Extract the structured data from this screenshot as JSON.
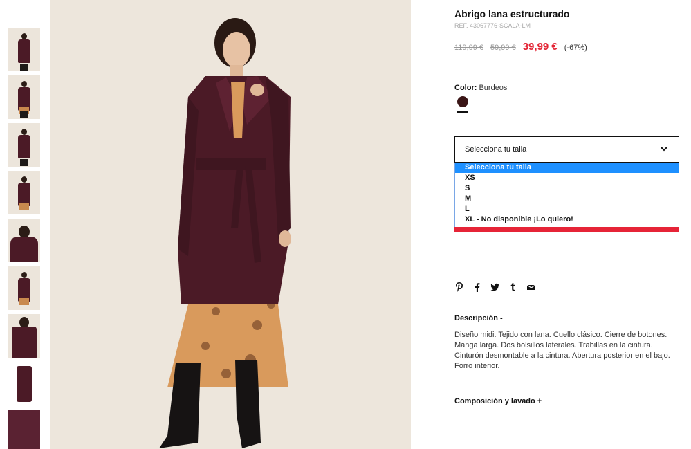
{
  "thumbnails": [
    {
      "alt": "front-full"
    },
    {
      "alt": "front-full-2"
    },
    {
      "alt": "front-walk"
    },
    {
      "alt": "front-mid"
    },
    {
      "alt": "closeup"
    },
    {
      "alt": "side"
    },
    {
      "alt": "back"
    },
    {
      "alt": "flat"
    },
    {
      "alt": "detail"
    }
  ],
  "product": {
    "title": "Abrigo lana estructurado",
    "ref": "REF. 43067776-SCALA-LM",
    "prices": {
      "original": "119,99 €",
      "previous": "59,99 €",
      "sale": "39,99 €",
      "discount": "(-67%)"
    },
    "color": {
      "label": "Color:",
      "value": "Burdeos",
      "swatch_hex": "#3a1516"
    },
    "size": {
      "placeholder": "Selecciona tu talla",
      "options": [
        "Selecciona tu talla",
        "XS",
        "S",
        "M",
        "L",
        "XL - No disponible ¡Lo quiero!"
      ],
      "selected_index": 0
    },
    "share_icons": [
      "pinterest-icon",
      "facebook-icon",
      "twitter-icon",
      "tumblr-icon",
      "email-icon"
    ],
    "description": {
      "title": "Descripción -",
      "text": "Diseño midi. Tejido con lana. Cuello clásico. Cierre de botones. Manga larga. Dos bolsillos laterales. Trabillas en la cintura. Cinturón desmontable a la cintura. Abertura posterior en el bajo. Forro interior."
    },
    "composition": {
      "title": "Composición y lavado +"
    }
  },
  "colors": {
    "accent_red": "#e32434",
    "select_highlight": "#1e90ff",
    "coat": "#4b1a26"
  }
}
